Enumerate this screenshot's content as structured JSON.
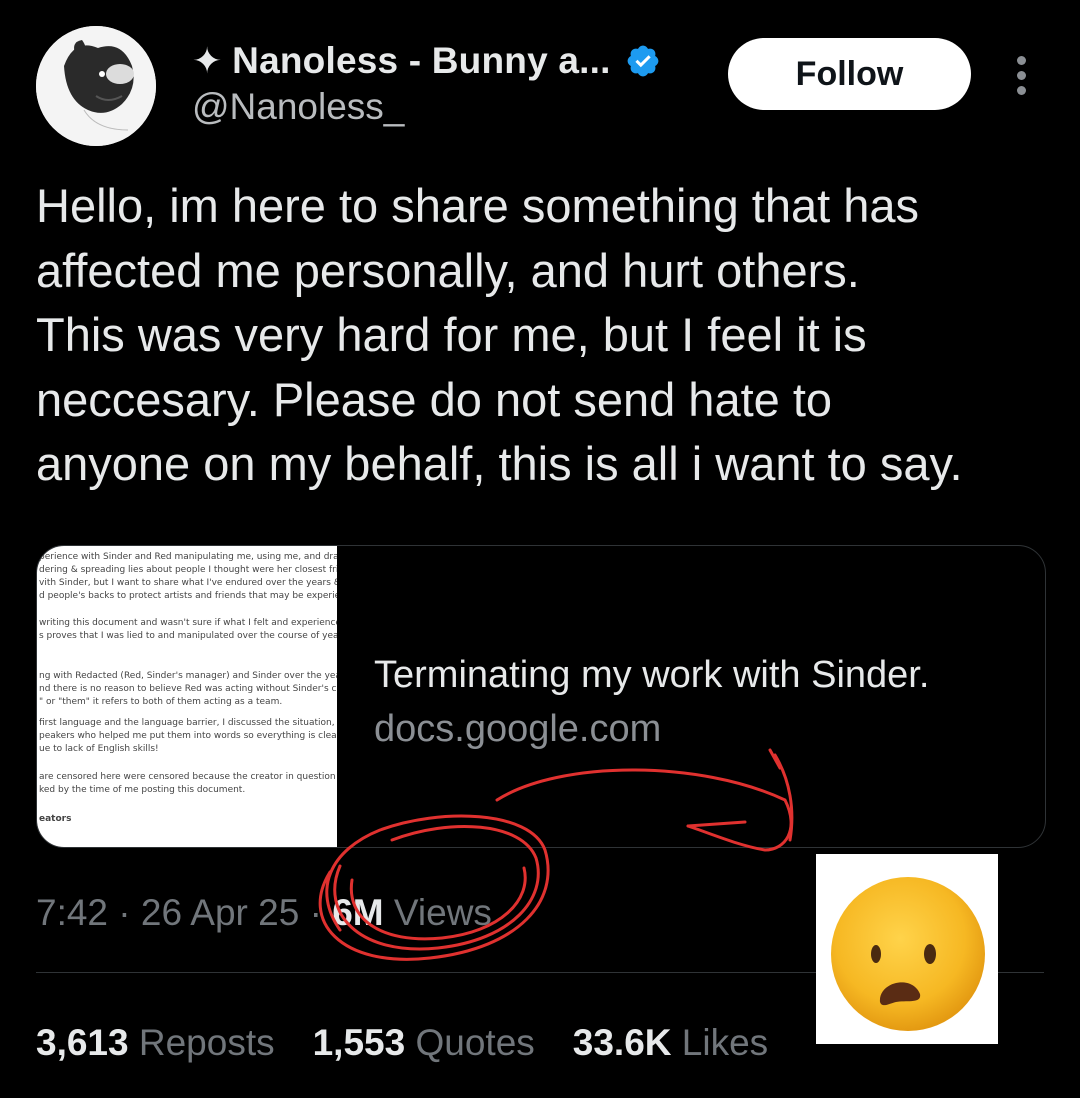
{
  "author": {
    "display_name": "Nanoless - Bunny a...",
    "handle": "@Nanoless_",
    "sparkle_icon": "✦"
  },
  "follow_label": "Follow",
  "tweet": {
    "lines": [
      "Hello, im here to share something that has",
      "affected me personally, and hurt others.",
      "This was very hard for me, but I feel it is",
      "neccesary. Please do not send hate to",
      "anyone on my behalf, this is all i want to say."
    ]
  },
  "link_card": {
    "title": "Terminating my work with Sinder.",
    "domain": "docs.google.com",
    "thumbnail_lines": [
      "perience with Sinder and Red manipulating me, using me, and dragg",
      "dering & spreading lies about people I thought were her closest friend",
      "vith Sinder, but I want to share what I've endured over the years & shed",
      "d people's backs to protect artists and friends that may be experiencing",
      "writing this document and wasn't sure if what I felt and experienced w",
      "s proves that I was lied to and manipulated over the course of years wh",
      "ng with Redacted (Red, Sinder's manager) and Sinder over the years th",
      "nd there is no reason to believe Red was acting without Sinder's conse",
      "\" or \"them\" it refers to both of them acting as a team.",
      "first language and the language barrier, I discussed the situation, my fe",
      "peakers who helped me put them into words so everything is clear with",
      "ue to lack of English skills!",
      "are censored here were censored because the creator in question did n",
      "ked by the time of me posting this document.",
      "eators"
    ]
  },
  "meta": {
    "time": "7:42",
    "separator": "·",
    "date": "26 Apr 25",
    "views_count": "6M",
    "views_label": "Views"
  },
  "stats": {
    "reposts_count": "3,613",
    "reposts_label": "Reposts",
    "quotes_count": "1,553",
    "quotes_label": "Quotes",
    "likes_count": "33.6K",
    "likes_label": "Likes"
  },
  "colors": {
    "background": "#000000",
    "text": "#e7e9ea",
    "muted": "#71767b",
    "verified": "#1d9bf0",
    "annotation": "#e0312f",
    "emoji_face": "#f6b823"
  }
}
